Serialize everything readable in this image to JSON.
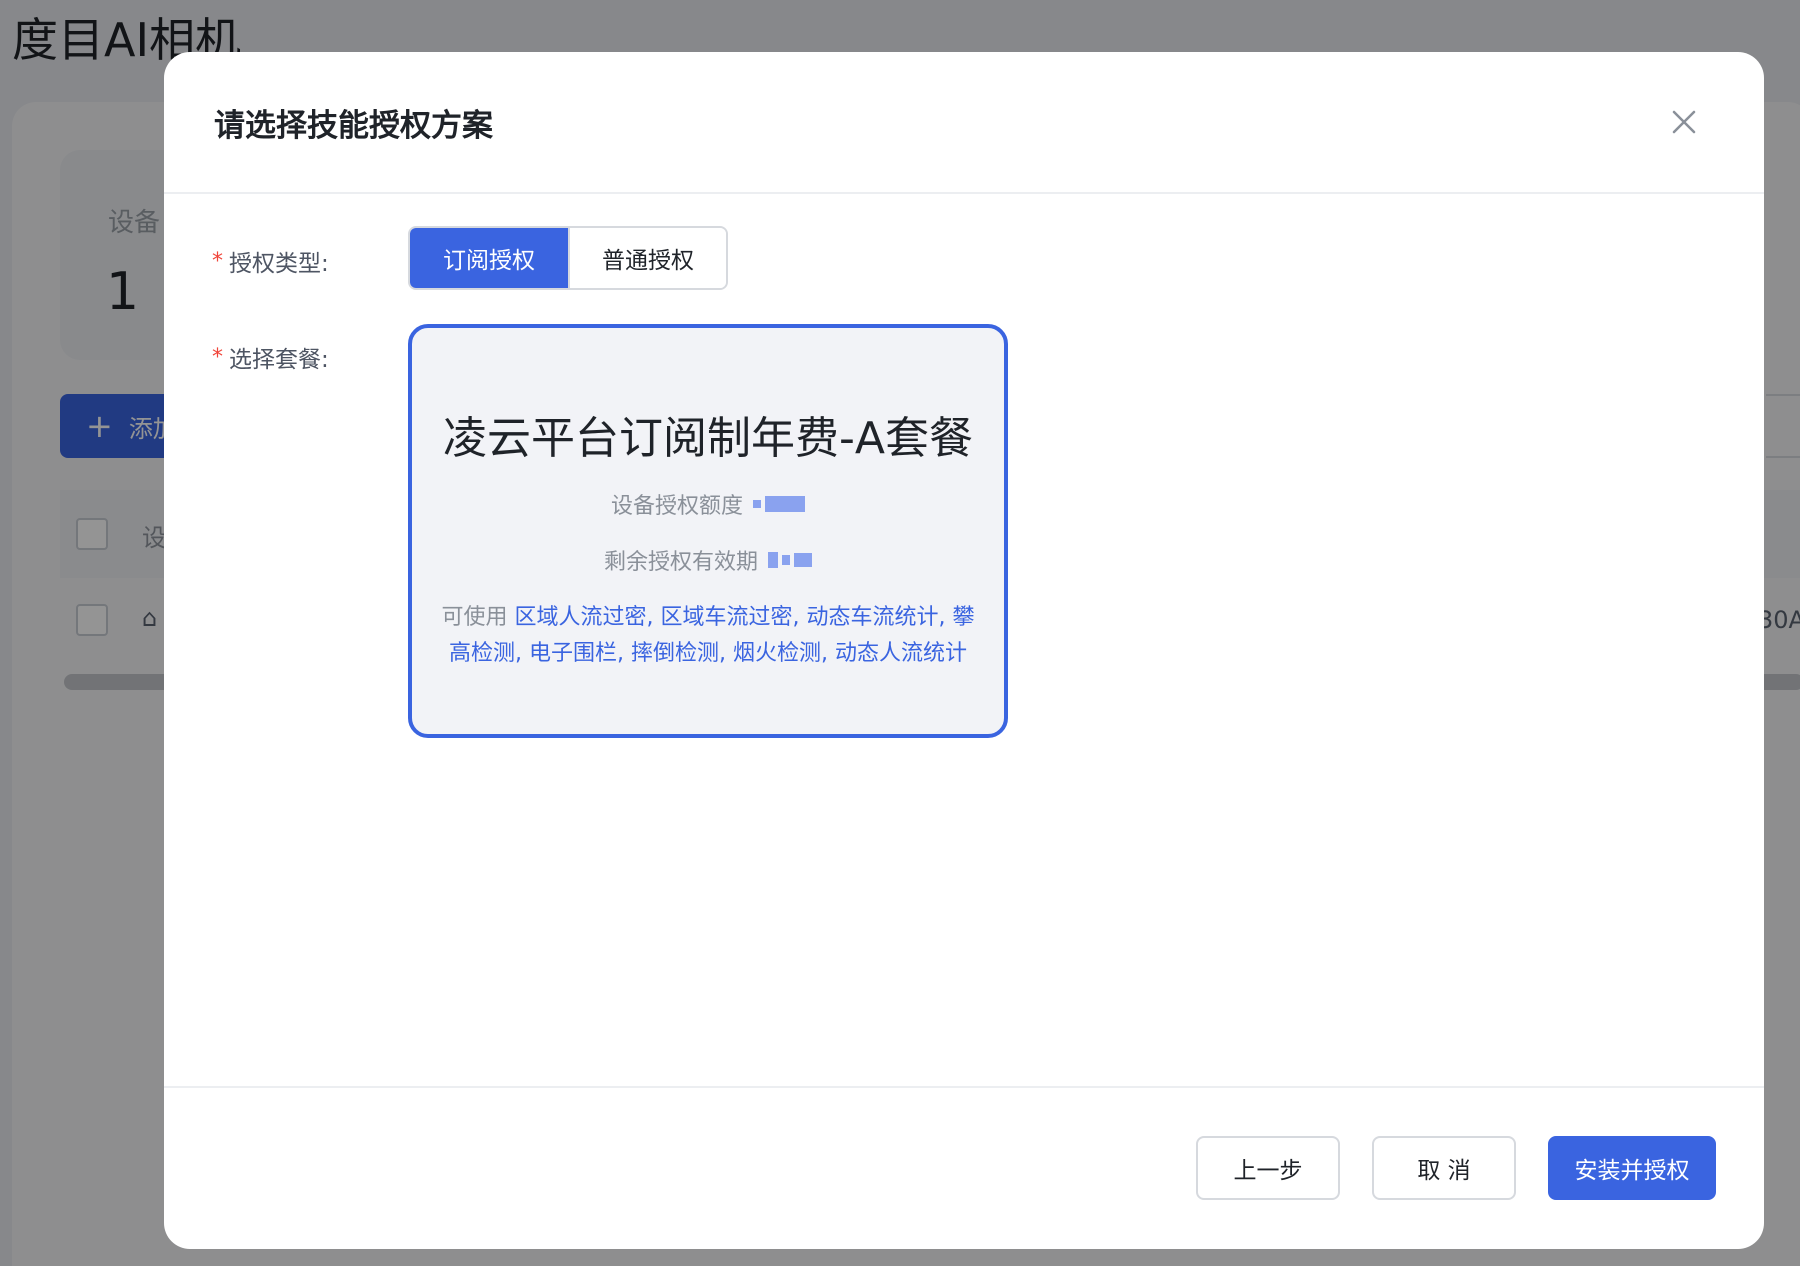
{
  "background": {
    "page_title": "度目AI相机",
    "stat_label": "设备",
    "stat_value": "1",
    "add_button_label": "添加",
    "table_header": "设",
    "row_tail_text": "30A"
  },
  "modal": {
    "title": "请选择技能授权方案",
    "auth_type": {
      "label": "授权类型:",
      "options": [
        {
          "label": "订阅授权",
          "selected": true
        },
        {
          "label": "普通授权",
          "selected": false
        }
      ]
    },
    "package": {
      "label": "选择套餐:",
      "card": {
        "title": "凌云平台订阅制年费-A套餐",
        "quota_label": "设备授权额度",
        "validity_label": "剩余授权有效期",
        "skills_prefix": "可使用",
        "skills": "区域人流过密, 区域车流过密, 动态车流统计, 攀高检测, 电子围栏, 摔倒检测, 烟火检测, 动态人流统计",
        "selected": true
      }
    },
    "footer": {
      "prev_label": "上一步",
      "cancel_label": "取 消",
      "submit_label": "安装并授权"
    }
  },
  "colors": {
    "primary": "#3a64e0",
    "required_mark": "#f0453a",
    "card_bg": "#f2f3f7"
  }
}
